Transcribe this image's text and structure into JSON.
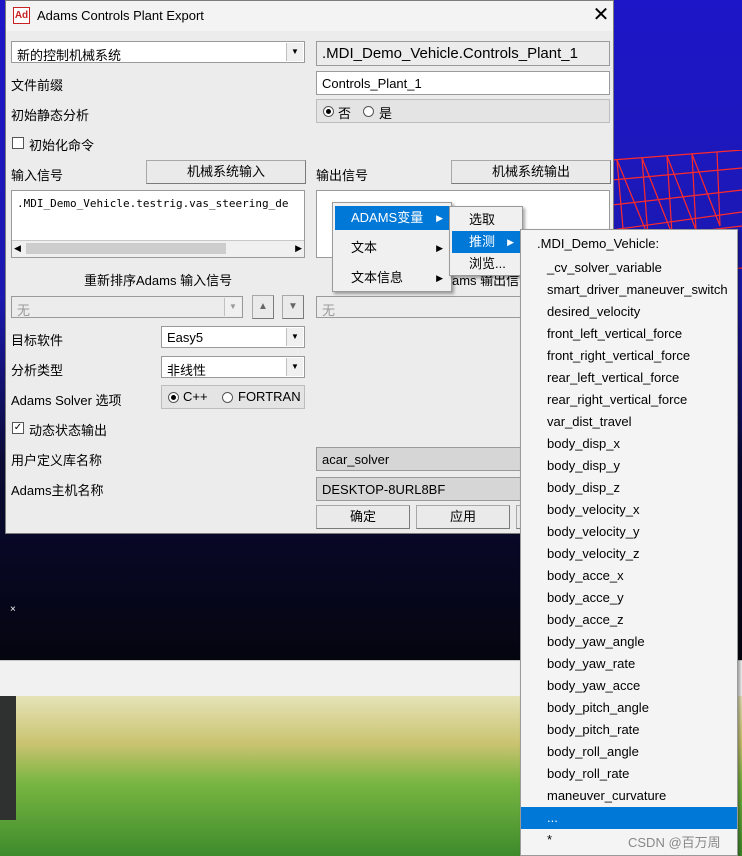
{
  "window": {
    "title": "Adams Controls Plant Export",
    "icon_text": "Ad",
    "close_glyph": "✕"
  },
  "form": {
    "system_select": "新的控制机械系统",
    "plant_name": ".MDI_Demo_Vehicle.Controls_Plant_1",
    "file_prefix_label": "文件前缀",
    "file_prefix_value": "Controls_Plant_1",
    "initial_static_label": "初始静态分析",
    "initial_static_no": "否",
    "initial_static_yes": "是",
    "init_commands_label": "初始化命令",
    "input_signal_label": "输入信号",
    "input_signal_button": "机械系统输入",
    "output_signal_label": "输出信号",
    "output_signal_button": "机械系统输出",
    "input_signal_list_value": ".MDI_Demo_Vehicle.testrig.vas_steering_de",
    "reorder_input_label": "重新排序Adams 输入信号",
    "reorder_output_partial": "ams 输出信",
    "input_order_select": "无",
    "output_order_select": "无",
    "target_software_label": "目标软件",
    "target_software_value": "Easy5",
    "analysis_type_label": "分析类型",
    "analysis_type_value": "非线性",
    "solver_label": "Adams Solver 选项",
    "solver_cpp": "C++",
    "solver_fortran": "FORTRAN",
    "dynamic_state_label": "动态状态输出",
    "user_lib_label": "用户定义库名称",
    "user_lib_value": "acar_solver",
    "host_label": "Adams主机名称",
    "host_value": "DESKTOP-8URL8BF",
    "ok_button": "确定",
    "apply_button": "应用"
  },
  "context_menu": {
    "items": [
      {
        "label": "ADAMS变量",
        "highlighted": true
      },
      {
        "label": "文本",
        "highlighted": false
      },
      {
        "label": "文本信息",
        "highlighted": false
      }
    ],
    "submenu": [
      {
        "label": "选取",
        "highlighted": false
      },
      {
        "label": "推测",
        "highlighted": true
      },
      {
        "label": "浏览...",
        "highlighted": false
      }
    ]
  },
  "variable_list": {
    "header": ".MDI_Demo_Vehicle:",
    "items": [
      "_cv_solver_variable",
      "smart_driver_maneuver_switch",
      "desired_velocity",
      "front_left_vertical_force",
      "front_right_vertical_force",
      "rear_left_vertical_force",
      "rear_right_vertical_force",
      "var_dist_travel",
      "body_disp_x",
      "body_disp_y",
      "body_disp_z",
      "body_velocity_x",
      "body_velocity_y",
      "body_velocity_z",
      "body_acce_x",
      "body_acce_y",
      "body_acce_z",
      "body_yaw_angle",
      "body_yaw_rate",
      "body_yaw_acce",
      "body_pitch_angle",
      "body_pitch_rate",
      "body_roll_angle",
      "body_roll_rate",
      "maneuver_curvature",
      "...",
      "*"
    ],
    "selected_index": 25
  },
  "watermark": "CSDN @百万周",
  "colors": {
    "highlight": "#0078d7",
    "dialog_bg": "#ececec"
  }
}
